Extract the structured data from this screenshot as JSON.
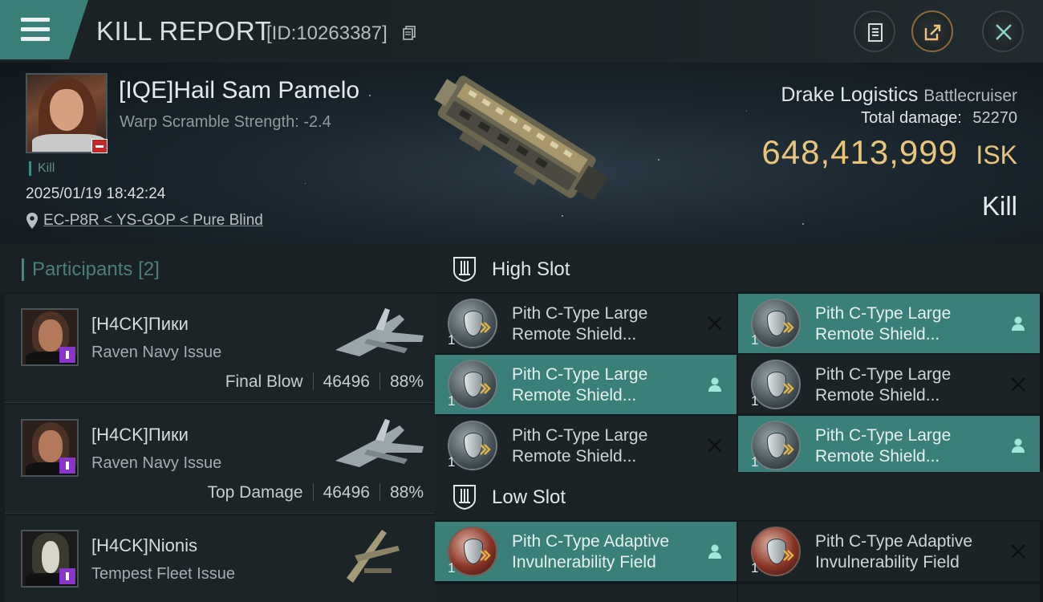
{
  "header": {
    "title": "KILL REPORT",
    "id_text": "[ID:10263387]"
  },
  "victim": {
    "name": "[IQE]Hail Sam Pamelo",
    "warp_scramble": "Warp Scramble Strength: -2.4",
    "tag": "Kill",
    "datetime": "2025/01/19 18:42:24",
    "location": "EC-P8R < YS-GOP < Pure Blind",
    "ship_name": "Drake Logistics",
    "ship_class": "Battlecruiser",
    "total_damage_label": "Total damage:",
    "total_damage": "52270",
    "isk_value": "648,413,999",
    "isk_unit": "ISK",
    "result": "Kill"
  },
  "participants": {
    "label": "Participants",
    "count": "[2]",
    "rows": [
      {
        "name": "[H4CK]Пики",
        "ship": "Raven Navy Issue",
        "role": "Final Blow",
        "damage": "46496",
        "percent": "88%"
      },
      {
        "name": "[H4CK]Пики",
        "ship": "Raven Navy Issue",
        "role": "Top Damage",
        "damage": "46496",
        "percent": "88%"
      },
      {
        "name": "[H4CK]Nionis",
        "ship": "Tempest Fleet Issue",
        "role": "",
        "damage": "",
        "percent": ""
      }
    ]
  },
  "fitting": {
    "high_slot_label": "High Slot",
    "low_slot_label": "Low Slot",
    "high_slot": [
      {
        "name": "Pith C-Type Large Remote Shield...",
        "qty": "1",
        "status": "destroyed"
      },
      {
        "name": "Pith C-Type Large Remote Shield...",
        "qty": "1",
        "status": "dropped"
      },
      {
        "name": "Pith C-Type Large Remote Shield...",
        "qty": "1",
        "status": "dropped"
      },
      {
        "name": "Pith C-Type Large Remote Shield...",
        "qty": "1",
        "status": "destroyed"
      },
      {
        "name": "Pith C-Type Large Remote Shield...",
        "qty": "1",
        "status": "destroyed"
      },
      {
        "name": "Pith C-Type Large Remote Shield...",
        "qty": "1",
        "status": "dropped"
      }
    ],
    "low_slot": [
      {
        "name": "Pith C-Type Adaptive Invulnerability Field",
        "qty": "1",
        "status": "dropped"
      },
      {
        "name": "Pith C-Type Adaptive Invulnerability Field",
        "qty": "1",
        "status": "destroyed"
      }
    ]
  },
  "colors": {
    "accent_teal": "#3a7f78",
    "isk_gold": "#e8c57a",
    "role_purple": "#8a35c9",
    "corp_red": "#c0282c"
  },
  "icons": {
    "menu": "hamburger-menu-icon",
    "copy": "copy-icon",
    "notes": "clipboard-icon",
    "share": "share-export-icon",
    "close": "close-icon",
    "location": "location-pin-icon",
    "destroyed": "x-destroyed-icon",
    "dropped": "person-dropped-icon"
  }
}
